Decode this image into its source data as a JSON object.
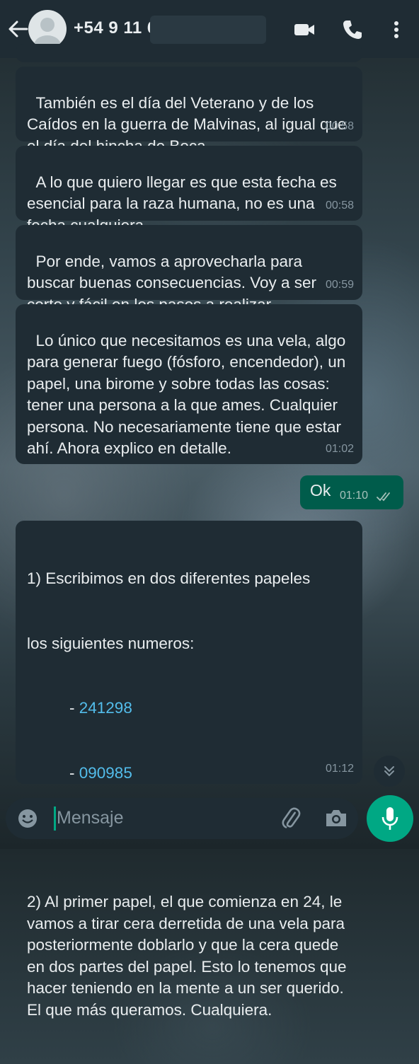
{
  "header": {
    "contact": "+54 9 11 6",
    "icons": [
      "back-arrow-icon",
      "avatar-icon",
      "video-call-icon",
      "phone-call-icon",
      "more-options-icon"
    ]
  },
  "messages": [
    {
      "text": "También es el día del Veterano y de los Caídos en la guerra de Malvinas, al igual que el día del hincha de Boca.",
      "time": "00:58"
    },
    {
      "text": "A lo que quiero llegar es que esta fecha es esencial para la raza humana, no es una fecha cualquiera.",
      "time": "00:58"
    },
    {
      "text": "Por ende, vamos a aprovecharla para buscar buenas consecuencias. Voy a ser corto y fácil en los pasos a realizar.",
      "time": "00:59"
    },
    {
      "text": "Lo único que necesitamos es una vela, algo para generar fuego (fósforo, encendedor), un papel, una birome y sobre todas las cosas: tener una persona a la que ames. Cualquier persona. No necesariamente tiene que estar ahí. Ahora explico en detalle.",
      "time": "01:02"
    }
  ],
  "outgoing": {
    "text": "Ok",
    "time": "01:10"
  },
  "last_message": {
    "line1": "1) Escribimos en dos diferentes papeles",
    "line2": "los siguientes numeros:",
    "dash1": "- ",
    "num1": "241298",
    "dash2": "- ",
    "num2": "090985",
    "para2": "2) Al primer papel, el que comienza en 24, le vamos a tirar cera derretida de una vela para posteriormente doblarlo y que la cera quede en dos partes del papel. Esto lo tenemos que hacer teniendo en la mente a un ser querido. El que más queramos. Cualquiera.",
    "time": "01:12"
  },
  "input": {
    "placeholder": "Mensaje"
  },
  "colors": {
    "header": "#1f2c34",
    "incoming": "#1f2c34",
    "outgoing": "#005c4b",
    "accent": "#00a884",
    "link": "#53bdeb"
  }
}
